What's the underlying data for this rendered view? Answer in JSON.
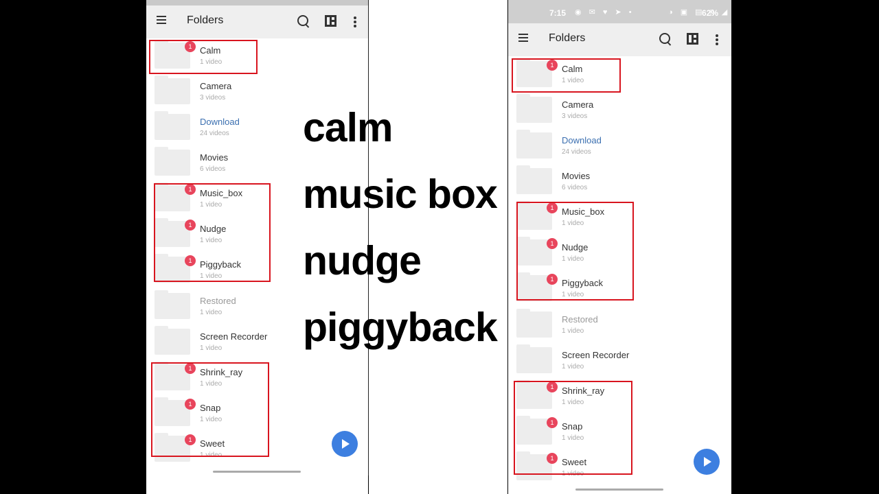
{
  "app": {
    "title": "Folders"
  },
  "status_bar": {
    "time": "7:15",
    "battery": "62%"
  },
  "folders": [
    {
      "name": "Calm",
      "count": "1 video",
      "badge": "1"
    },
    {
      "name": "Camera",
      "count": "3 videos",
      "badge": ""
    },
    {
      "name": "Download",
      "count": "24 videos",
      "badge": ""
    },
    {
      "name": "Movies",
      "count": "6 videos",
      "badge": ""
    },
    {
      "name": "Music_box",
      "count": "1 video",
      "badge": "1"
    },
    {
      "name": "Nudge",
      "count": "1 video",
      "badge": "1"
    },
    {
      "name": "Piggyback",
      "count": "1 video",
      "badge": "1"
    },
    {
      "name": "Restored",
      "count": "1 video",
      "badge": ""
    },
    {
      "name": "Screen Recorder",
      "count": "1 video",
      "badge": ""
    },
    {
      "name": "Shrink_ray",
      "count": "1 video",
      "badge": "1"
    },
    {
      "name": "Snap",
      "count": "1 video",
      "badge": "1"
    },
    {
      "name": "Sweet",
      "count": "1 video",
      "badge": "1"
    }
  ],
  "overlay_text": [
    "calm",
    "music box",
    "nudge",
    "piggyback"
  ],
  "colors": {
    "badge": "#e8455c",
    "highlight": "#d8141e",
    "fab": "#3d7fe0",
    "link": "#3b6fb0"
  },
  "icons": [
    "menu-icon",
    "search-icon",
    "layout-icon",
    "more-vert-icon",
    "play-icon",
    "folder-icon"
  ]
}
